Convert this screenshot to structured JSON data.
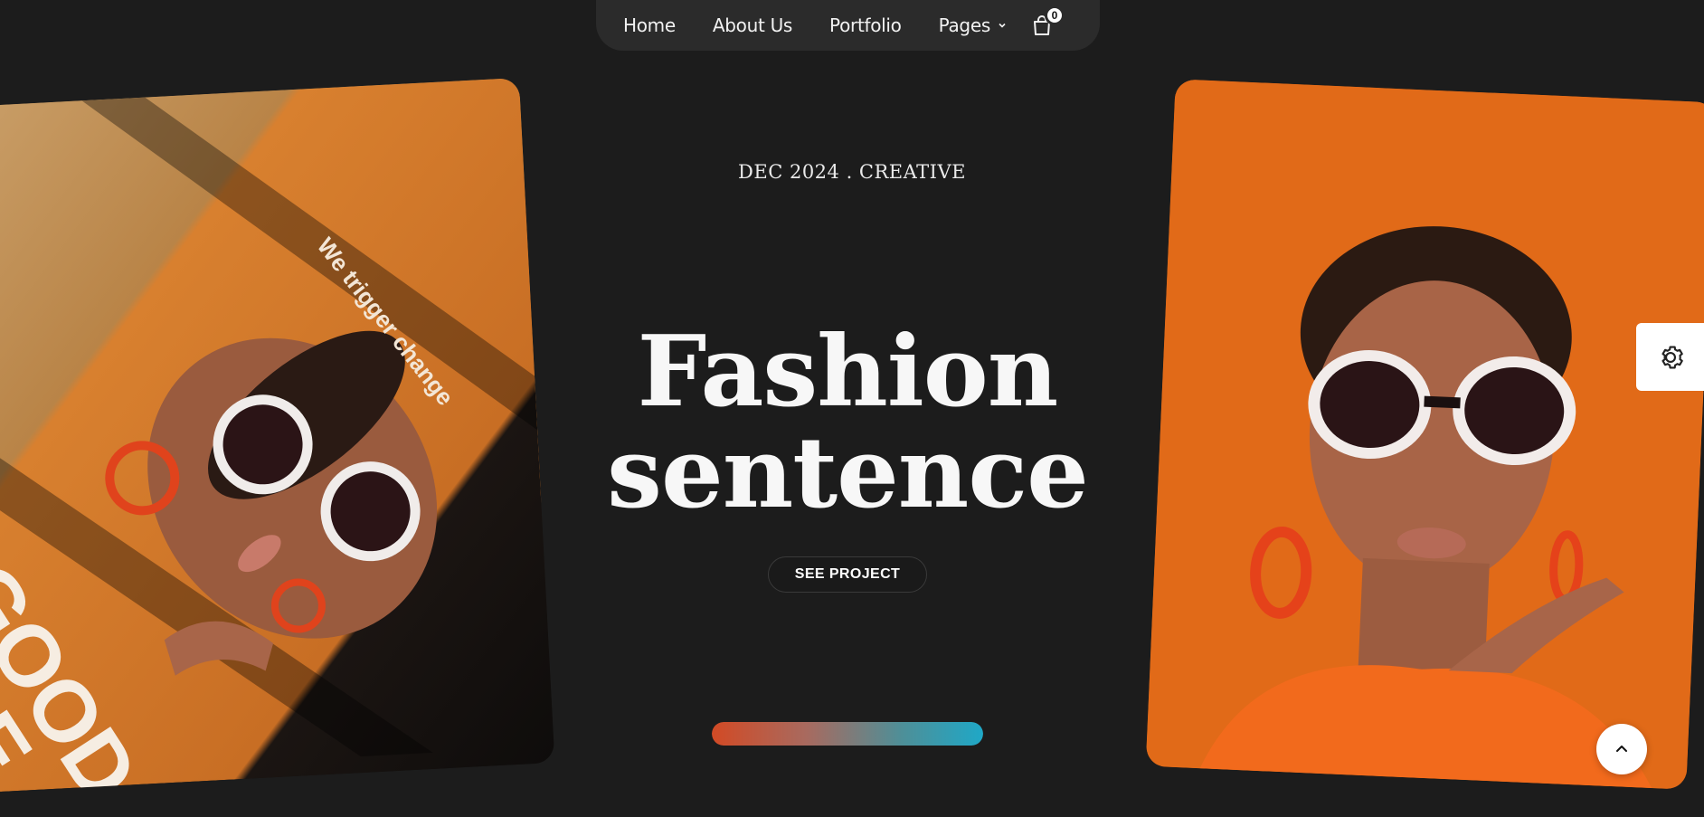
{
  "nav": {
    "items": [
      {
        "label": "Home"
      },
      {
        "label": "About Us"
      },
      {
        "label": "Portfolio"
      },
      {
        "label": "Pages"
      }
    ],
    "cart_count": "0",
    "icons": {
      "pages_dropdown": "chevron-down-icon",
      "cart": "shopping-bag-icon"
    }
  },
  "hero": {
    "eyebrow": "DEC 2024 . CREATIVE",
    "title_line1": "Fashion",
    "title_line2": "sentence",
    "cta_label": "SEE PROJECT",
    "progress": 1.0
  },
  "left_card": {
    "magazine_tagline": "We trigger change",
    "magazine_title_line1": "EGOOD",
    "magazine_title_line2": "OUPE"
  },
  "widgets": {
    "settings_icon": "gear-icon",
    "scroll_top_icon": "chevron-up-icon"
  },
  "colors": {
    "background": "#1c1c1c",
    "nav_bg": "#2b2b2b",
    "accent_orange": "#e16a18",
    "progress_start": "#d24a25",
    "progress_end": "#1fa8c7"
  }
}
